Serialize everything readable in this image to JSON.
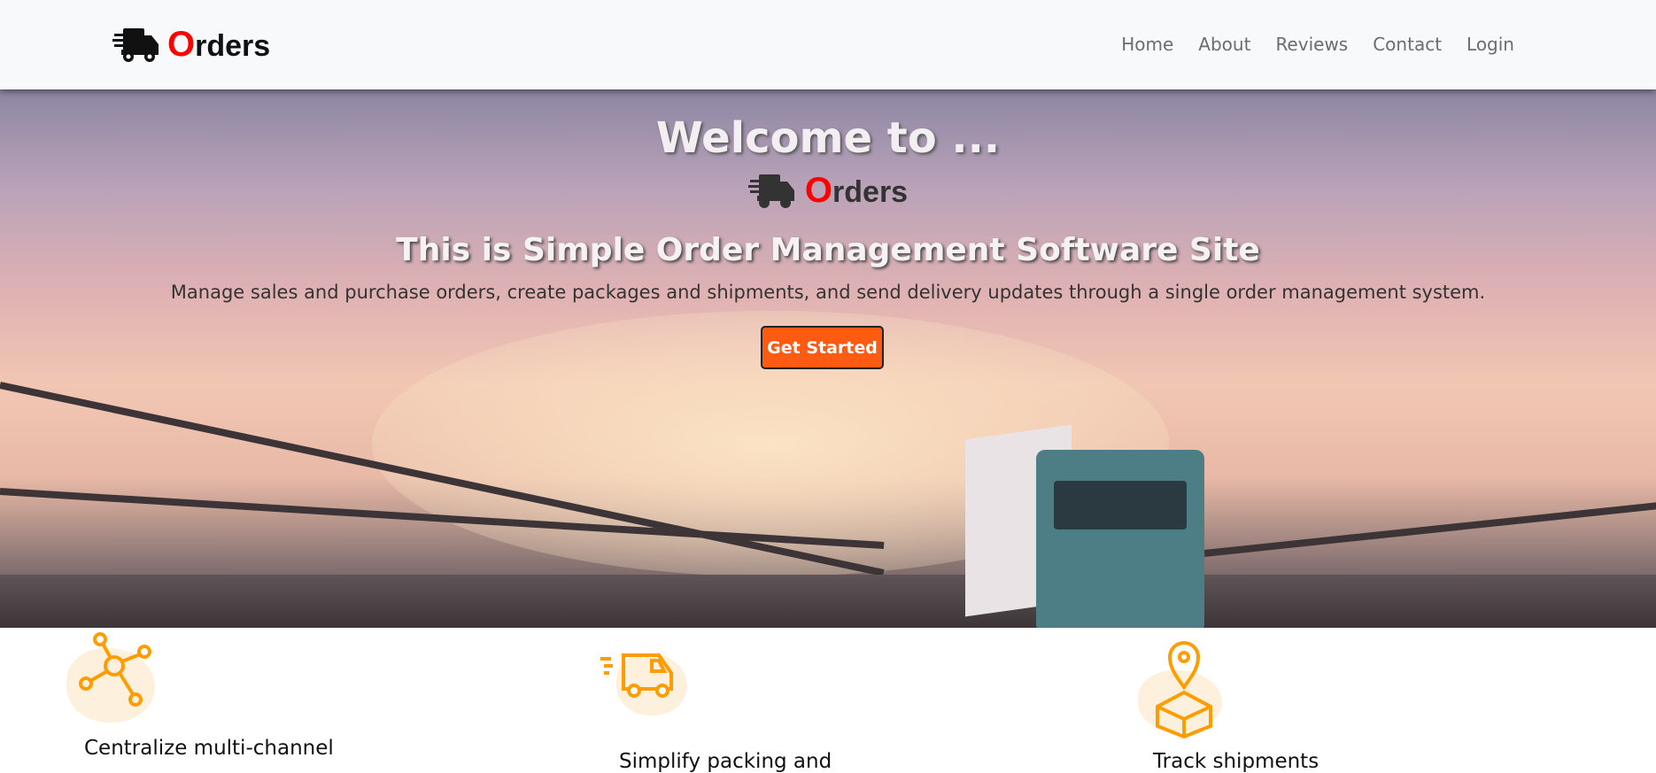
{
  "brand": {
    "first_letter": "O",
    "rest": "rders"
  },
  "nav": {
    "items": [
      "Home",
      "About",
      "Reviews",
      "Contact",
      "Login"
    ]
  },
  "hero": {
    "welcome": "Welcome to ...",
    "logo_first_letter": "O",
    "logo_rest": "rders",
    "subtitle": "This is Simple Order Management Software Site",
    "description": "Manage sales and purchase orders, create packages and shipments, and send delivery updates through a single order management system.",
    "cta": "Get Started"
  },
  "features": [
    {
      "icon": "network-hub-icon",
      "title": "Centralize multi-channel"
    },
    {
      "icon": "delivery-truck-icon",
      "title": "Simplify packing and"
    },
    {
      "icon": "location-box-icon",
      "title": "Track shipments"
    }
  ],
  "colors": {
    "accent": "#fd5a12",
    "icon": "#ff9d00",
    "logo_red": "#ff0000"
  }
}
